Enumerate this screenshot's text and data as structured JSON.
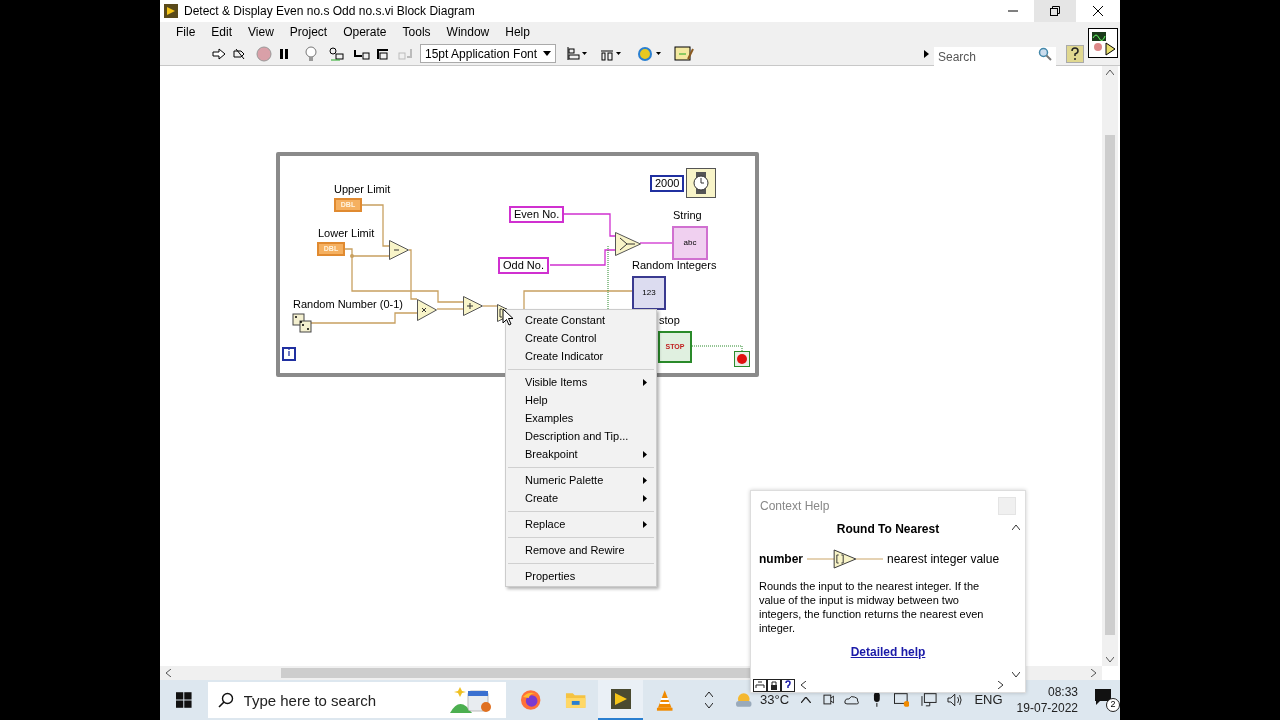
{
  "window": {
    "title": "Detect & Display Even no.s Odd no.s.vi Block Diagram"
  },
  "menu": [
    "File",
    "Edit",
    "View",
    "Project",
    "Operate",
    "Tools",
    "Window",
    "Help"
  ],
  "toolbar": {
    "font": "15pt Application Font",
    "search_placeholder": "Search"
  },
  "diagram": {
    "labels": [
      "Upper Limit",
      "Lower Limit",
      "Random Number (0-1)",
      "String",
      "Random Integers",
      "stop"
    ],
    "constants": [
      {
        "kind": "string",
        "text": "Even No."
      },
      {
        "kind": "string",
        "text": "Odd No."
      },
      {
        "kind": "numeric",
        "text": "2000"
      }
    ],
    "terminals": [
      {
        "kind": "dbl",
        "text": "DBL"
      },
      {
        "kind": "dbl",
        "text": "DBL"
      },
      {
        "kind": "string",
        "text": "abc"
      },
      {
        "kind": "numeric",
        "text": "123"
      },
      {
        "kind": "boolean",
        "text": "STOP"
      }
    ],
    "iteration": "i"
  },
  "context_menu": [
    [
      {
        "label": "Create Constant",
        "kind": "item"
      },
      {
        "label": "Create Control",
        "kind": "item"
      },
      {
        "label": "Create Indicator",
        "kind": "item"
      }
    ],
    [
      {
        "label": "Visible Items",
        "kind": "submenu"
      },
      {
        "label": "Help",
        "kind": "item"
      },
      {
        "label": "Examples",
        "kind": "item"
      },
      {
        "label": "Description and Tip...",
        "kind": "item"
      },
      {
        "label": "Breakpoint",
        "kind": "submenu"
      }
    ],
    [
      {
        "label": "Numeric Palette",
        "kind": "submenu"
      },
      {
        "label": "Create",
        "kind": "submenu"
      }
    ],
    [
      {
        "label": "Replace",
        "kind": "submenu"
      }
    ],
    [
      {
        "label": "Remove and Rewire",
        "kind": "item"
      }
    ],
    [
      {
        "label": "Properties",
        "kind": "item"
      }
    ]
  ],
  "context_help": {
    "title": "Context Help",
    "function": "Round To Nearest",
    "input": "number",
    "output": "nearest integer value",
    "description": "Rounds the input to the nearest integer. If the value of the input is midway between two integers, the function returns the nearest even integer.",
    "link": "Detailed help"
  },
  "taskbar": {
    "search_placeholder": "Type here to search",
    "temperature": "33°C",
    "language": "ENG",
    "time": "08:33",
    "date": "19-07-2022",
    "notifications": "2"
  }
}
